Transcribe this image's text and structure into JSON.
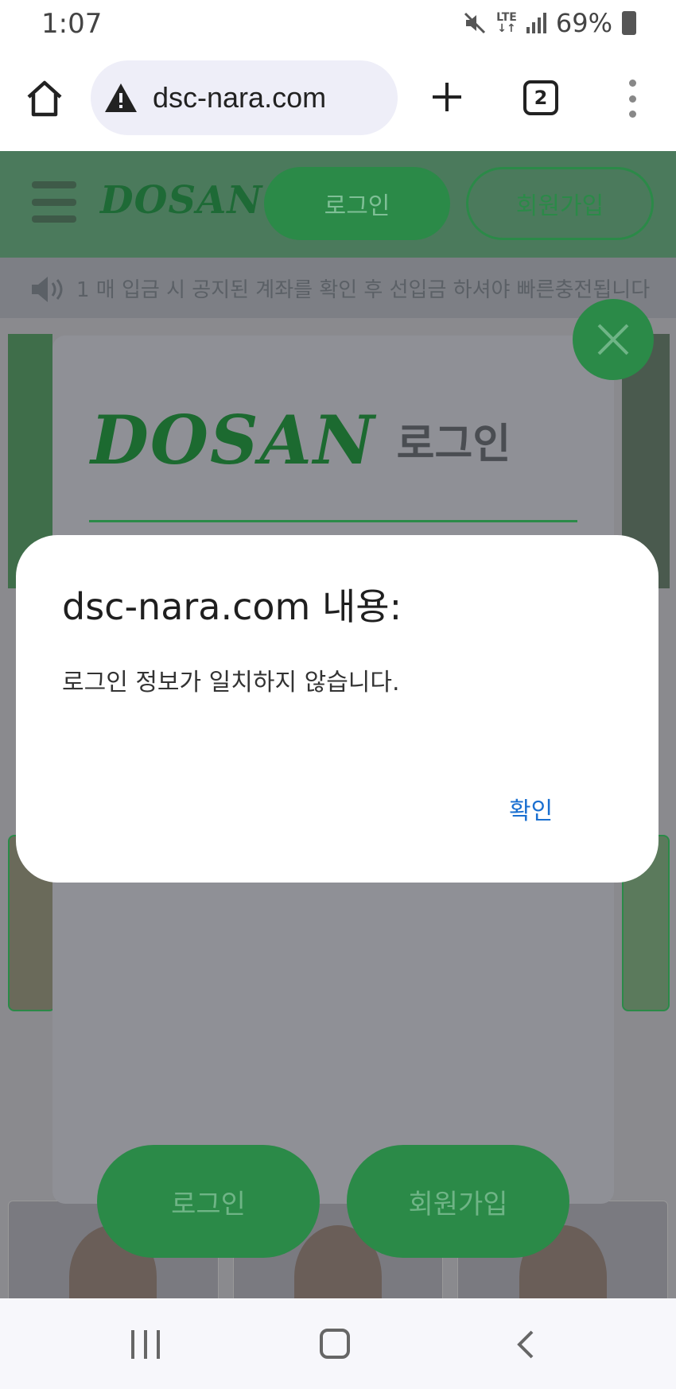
{
  "status_bar": {
    "time": "1:07",
    "network": "LTE",
    "battery": "69%"
  },
  "browser": {
    "url": "dsc-nara.com",
    "tab_count": "2",
    "icons": [
      "home-icon",
      "warning-icon",
      "plus-icon",
      "tabs-icon",
      "more-vert-icon"
    ]
  },
  "site": {
    "logo": "DOSAN",
    "header_login": "로그인",
    "header_signup": "회원가입",
    "notice": "1 매 입금 시 공지된 계좌를 확인 후 선입금 하셔야 빠른충전됩니다",
    "accent_color": "#2b8a48"
  },
  "login_modal": {
    "logo": "DOSAN",
    "title": "로그인",
    "login_button": "로그인",
    "signup_button": "회원가입"
  },
  "dialog": {
    "title": "dsc-nara.com 내용:",
    "message": "로그인 정보가 일치하지 않습니다.",
    "ok_button": "확인",
    "ok_color": "#1a6fd0"
  },
  "nav_bar": {
    "icons": [
      "recent-apps-icon",
      "home-icon",
      "back-icon"
    ]
  }
}
